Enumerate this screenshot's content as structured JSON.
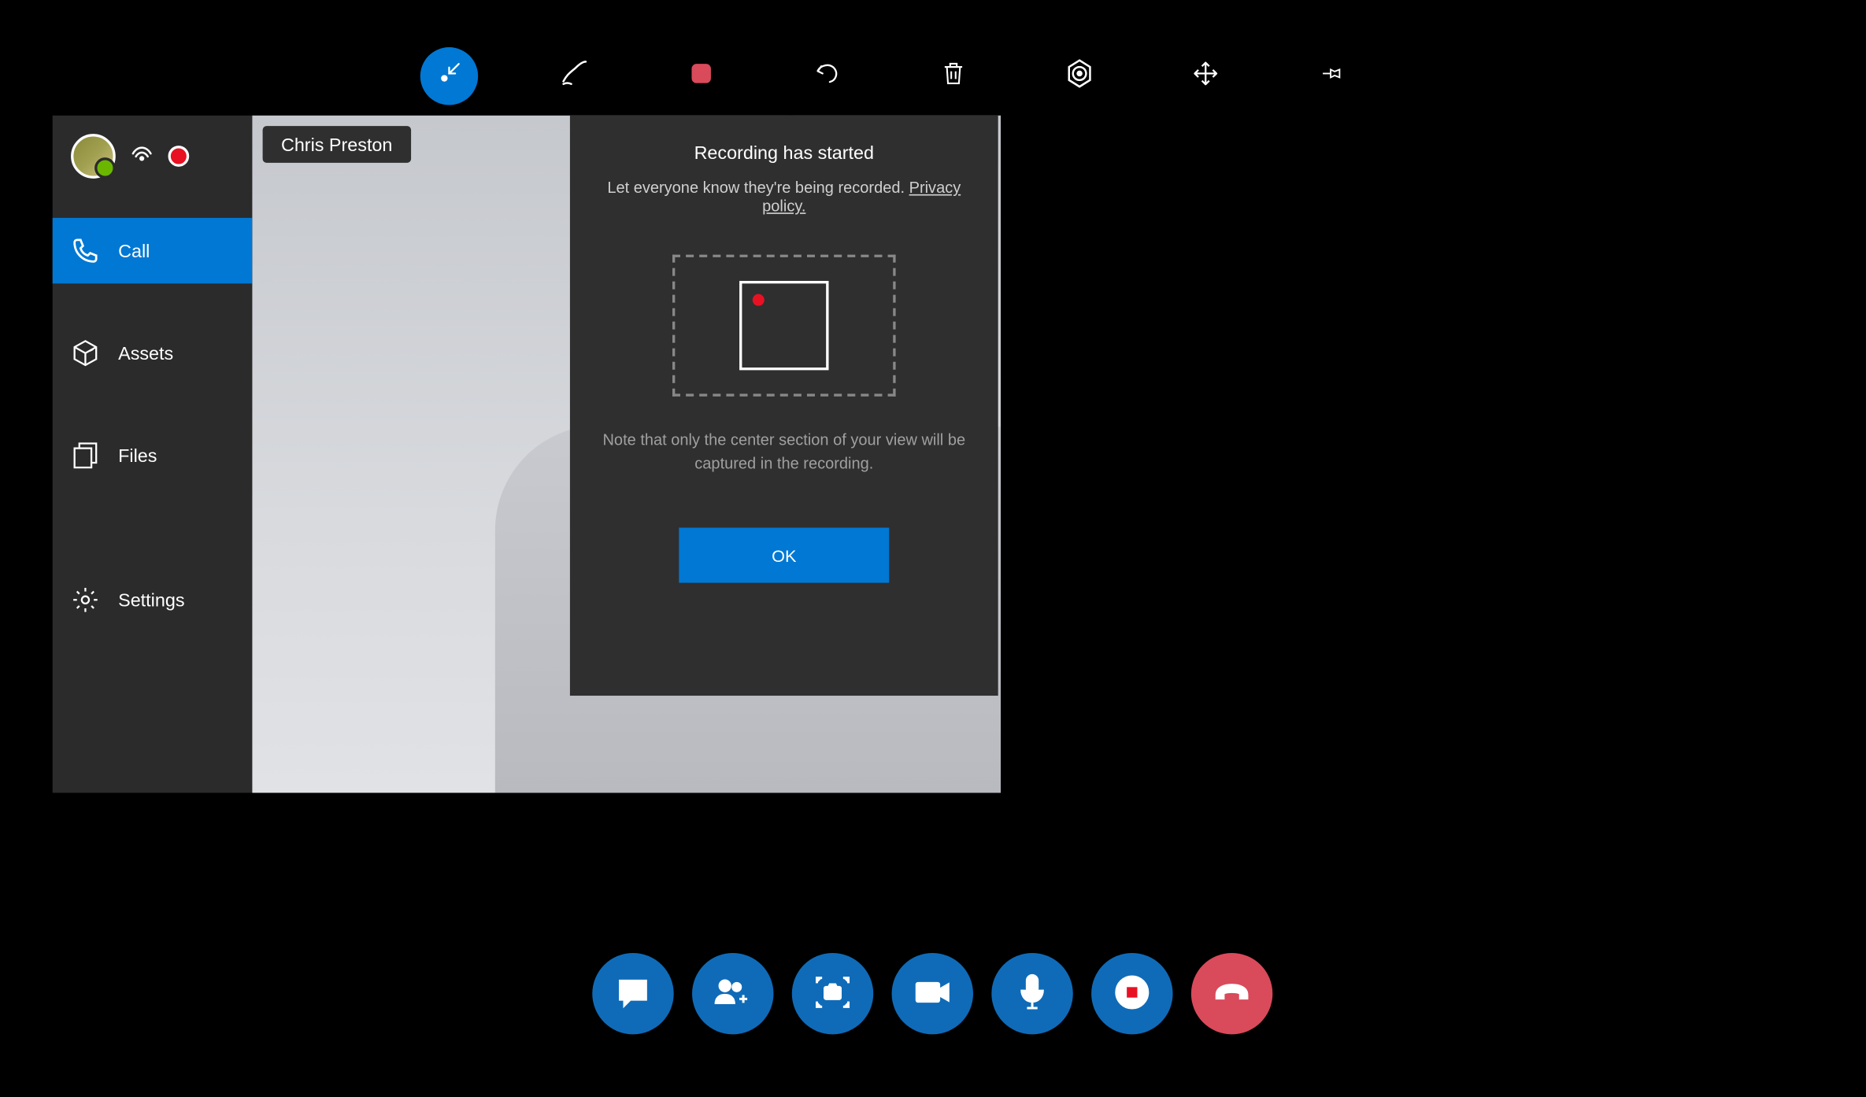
{
  "participant": {
    "name": "Chris Preston"
  },
  "sidebar": {
    "items": [
      {
        "label": "Call",
        "icon": "phone-icon"
      },
      {
        "label": "Assets",
        "icon": "box-icon"
      },
      {
        "label": "Files",
        "icon": "files-icon"
      },
      {
        "label": "Settings",
        "icon": "gear-icon"
      }
    ]
  },
  "toolbar": {
    "tools": [
      {
        "name": "arrow-tool",
        "icon": "arrow-in-icon",
        "active": true
      },
      {
        "name": "ink-tool",
        "icon": "ink-icon"
      },
      {
        "name": "stop-tool",
        "icon": "stop-square-icon"
      },
      {
        "name": "undo-tool",
        "icon": "undo-icon"
      },
      {
        "name": "delete-tool",
        "icon": "trash-icon"
      },
      {
        "name": "target-tool",
        "icon": "hex-target-icon"
      },
      {
        "name": "move-tool",
        "icon": "move-icon"
      },
      {
        "name": "pin-tool",
        "icon": "pin-icon"
      }
    ]
  },
  "dialog": {
    "title": "Recording has started",
    "subtitle_text": "Let everyone know they're being recorded. ",
    "privacy_link": "Privacy policy.",
    "note": "Note that only the center section of your view will be captured in the recording.",
    "ok_label": "OK"
  },
  "callControls": {
    "buttons": [
      {
        "name": "chat-button",
        "icon": "chat-icon"
      },
      {
        "name": "add-participant-button",
        "icon": "people-add-icon"
      },
      {
        "name": "capture-button",
        "icon": "camera-frame-icon"
      },
      {
        "name": "video-button",
        "icon": "video-icon"
      },
      {
        "name": "mic-button",
        "icon": "mic-icon"
      },
      {
        "name": "record-button",
        "icon": "record-stop-icon"
      },
      {
        "name": "end-call-button",
        "icon": "hangup-icon",
        "end": true
      }
    ]
  },
  "colors": {
    "accent": "#0078d4",
    "accent_dark": "#0f6bb8",
    "danger": "#d94a5b",
    "record_red": "#e81123",
    "bg_panel": "#2b2b2b",
    "bg_dialog": "#2f2f2f"
  }
}
